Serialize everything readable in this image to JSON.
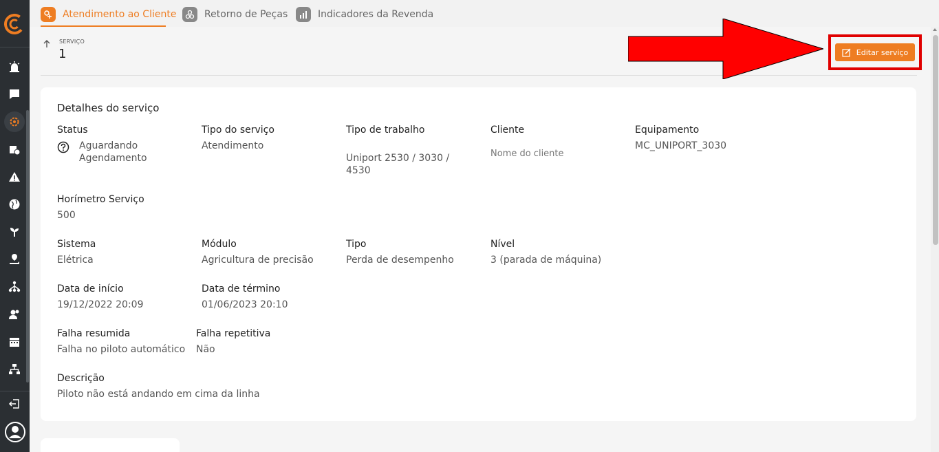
{
  "tabs": [
    {
      "label": "Atendimento ao Cliente",
      "icon": "service-icon",
      "active": true
    },
    {
      "label": "Retorno de Peças",
      "icon": "parts-icon",
      "active": false
    },
    {
      "label": "Indicadores da Revenda",
      "icon": "chart-icon",
      "active": false
    }
  ],
  "header": {
    "label": "SERVIÇO",
    "number": "1"
  },
  "edit_button": "Editar serviço",
  "details": {
    "title": "Detalhes do serviço",
    "status_label": "Status",
    "status_line1": "Aguardando",
    "status_line2": "Agendamento",
    "service_type_label": "Tipo do serviço",
    "service_type_value": "Atendimento",
    "work_type_label": "Tipo de trabalho",
    "work_type_line1": "Uniport 2530 / 3030 /",
    "work_type_line2": "4530",
    "client_label": "Cliente",
    "client_value": "Nome do cliente",
    "equipment_label": "Equipamento",
    "equipment_value": "MC_UNIPORT_3030",
    "hourmeter_label": "Horímetro Serviço",
    "hourmeter_value": "500",
    "system_label": "Sistema",
    "system_value": "Elétrica",
    "module_label": "Módulo",
    "module_value": "Agricultura de precisão",
    "type_label": "Tipo",
    "type_value": "Perda de desempenho",
    "level_label": "Nível",
    "level_value": "3 (parada de máquina)",
    "start_label": "Data de início",
    "start_value": "19/12/2022 20:09",
    "end_label": "Data de término",
    "end_value": "01/06/2023 20:10",
    "summary_label": "Falha resumida",
    "summary_value": "Falha no piloto automático",
    "repeat_label": "Falha repetitiva",
    "repeat_value": "Não",
    "desc_label": "Descrição",
    "desc_value": "Piloto não está andando em cima da linha"
  },
  "colors": {
    "accent": "#ee7d22",
    "sidebar": "#2b2f33",
    "highlight": "#e00000"
  }
}
